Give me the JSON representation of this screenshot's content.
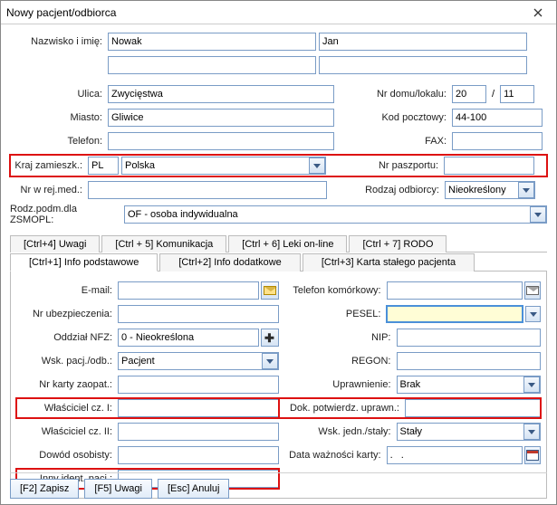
{
  "window": {
    "title": "Nowy pacjent/odbiorca"
  },
  "name": {
    "label": "Nazwisko i imię:",
    "surname": "Nowak",
    "given": "Jan",
    "surname2": "",
    "given2": ""
  },
  "addr": {
    "street_label": "Ulica:",
    "street": "Zwycięstwa",
    "house_label": "Nr domu/lokalu:",
    "house": "20",
    "flat": "11",
    "city_label": "Miasto:",
    "city": "Gliwice",
    "zip_label": "Kod pocztowy:",
    "zip": "44-100",
    "phone_label": "Telefon:",
    "phone": "",
    "fax_label": "FAX:",
    "fax": ""
  },
  "country": {
    "label": "Kraj zamieszk.:",
    "code": "PL",
    "name": "Polska"
  },
  "passport": {
    "label": "Nr paszportu:",
    "value": ""
  },
  "rejmed": {
    "label": "Nr w rej.med.:",
    "value": ""
  },
  "recipient_type": {
    "label": "Rodzaj odbiorcy:",
    "value": "Nieokreślony"
  },
  "zsmopl": {
    "label": "Rodz.podm.dla ZSMOPL:",
    "value": "OF - osoba indywidualna"
  },
  "tabs1": {
    "uwagi": "[Ctrl+4] Uwagi",
    "komunikacja": "[Ctrl + 5] Komunikacja",
    "leki": "[Ctrl + 6] Leki on-line",
    "rodo": "[Ctrl + 7] RODO"
  },
  "tabs2": {
    "info_podst": "[Ctrl+1] Info podstawowe",
    "info_dod": "[Ctrl+2] Info dodatkowe",
    "karta": "[Ctrl+3] Karta stałego pacjenta"
  },
  "info": {
    "email_label": "E-mail:",
    "email": "",
    "ubezp_label": "Nr ubezpieczenia:",
    "ubezp": "",
    "nfz_label": "Oddział NFZ:",
    "nfz": "0 - Nieokreślona",
    "wsk_label": "Wsk. pacj./odb.:",
    "wsk": "Pacjent",
    "karty_label": "Nr karty zaopat.:",
    "karty": "",
    "wl1_label": "Właściciel cz. I:",
    "wl1": "",
    "wl2_label": "Właściciel cz. II:",
    "wl2": "",
    "dowod_label": "Dowód osobisty:",
    "dowod": "",
    "inny_label": "Inny ident. pacj.:",
    "inny": "",
    "telkom_label": "Telefon komórkowy:",
    "telkom": "",
    "pesel_label": "PESEL:",
    "pesel": "",
    "nip_label": "NIP:",
    "nip": "",
    "regon_label": "REGON:",
    "regon": "",
    "upr_label": "Uprawnienie:",
    "upr": "Brak",
    "dokpot_label": "Dok. potwierdz. uprawn.:",
    "dokpot": "",
    "jedn_label": "Wsk. jedn./stały:",
    "jedn": "Stały",
    "datawazn_label": "Data ważności karty:",
    "datawazn": ".   ."
  },
  "footer": {
    "zapisz": "[F2] Zapisz",
    "uwagi": "[F5] Uwagi",
    "anuluj": "[Esc] Anuluj"
  }
}
